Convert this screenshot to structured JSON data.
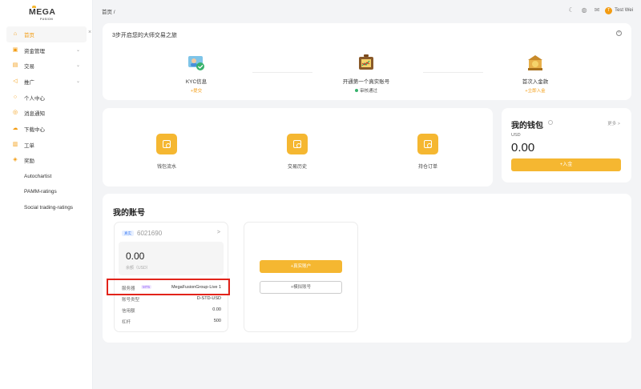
{
  "brand": {
    "logo": "MEGA",
    "logo_sub": "FUSION"
  },
  "sidebar": {
    "items": [
      {
        "label": "首页",
        "icon": "home-icon"
      },
      {
        "label": "资金管理",
        "icon": "wallet-icon"
      },
      {
        "label": "交易",
        "icon": "chart-icon"
      },
      {
        "label": "推广",
        "icon": "megaphone-icon"
      },
      {
        "label": "个人中心",
        "icon": "user-icon"
      },
      {
        "label": "消息通知",
        "icon": "bell-icon"
      },
      {
        "label": "下载中心",
        "icon": "download-icon"
      },
      {
        "label": "工单",
        "icon": "ticket-icon"
      },
      {
        "label": "奖励",
        "icon": "gift-icon"
      },
      {
        "label": "Autochartist"
      },
      {
        "label": "PAMM-ratings"
      },
      {
        "label": "Social trading-ratings"
      }
    ]
  },
  "topbar": {
    "breadcrumb": "首页 /",
    "user_initial": "T",
    "user_name": "Test Wei"
  },
  "steps": {
    "title": "3步开启您的大师交易之旅",
    "items": [
      {
        "label": "KYC信息",
        "sub": "+提交"
      },
      {
        "label": "开通第一个真实账号",
        "sub": "审核通过"
      },
      {
        "label": "首次入金款",
        "sub": "+立即入金"
      }
    ]
  },
  "quick": {
    "items": [
      {
        "label": "钱包流水"
      },
      {
        "label": "交易历史"
      },
      {
        "label": "持仓订单"
      }
    ]
  },
  "wallet": {
    "title": "我的钱包",
    "more": "更多 >",
    "currency": "USD",
    "amount": "0.00",
    "button": "+入金"
  },
  "accounts": {
    "title": "我的账号",
    "card": {
      "badge": "真实",
      "number": "6021690",
      "arrow": ">",
      "balance": "0.00",
      "balance_label": "余额（USD）",
      "rows": [
        {
          "k": "服务器",
          "tag": "MT5",
          "v": "MegaFusionGroup-Live 1"
        },
        {
          "k": "账号类型",
          "v": "D-STD-USD"
        },
        {
          "k": "信用额",
          "v": "0.00"
        },
        {
          "k": "杠杆",
          "v": "500"
        }
      ]
    },
    "open_real": "+真实账户",
    "open_demo": "+模拟账号"
  },
  "colors": {
    "accent": "#f5b731",
    "highlight": "#e2231a"
  }
}
